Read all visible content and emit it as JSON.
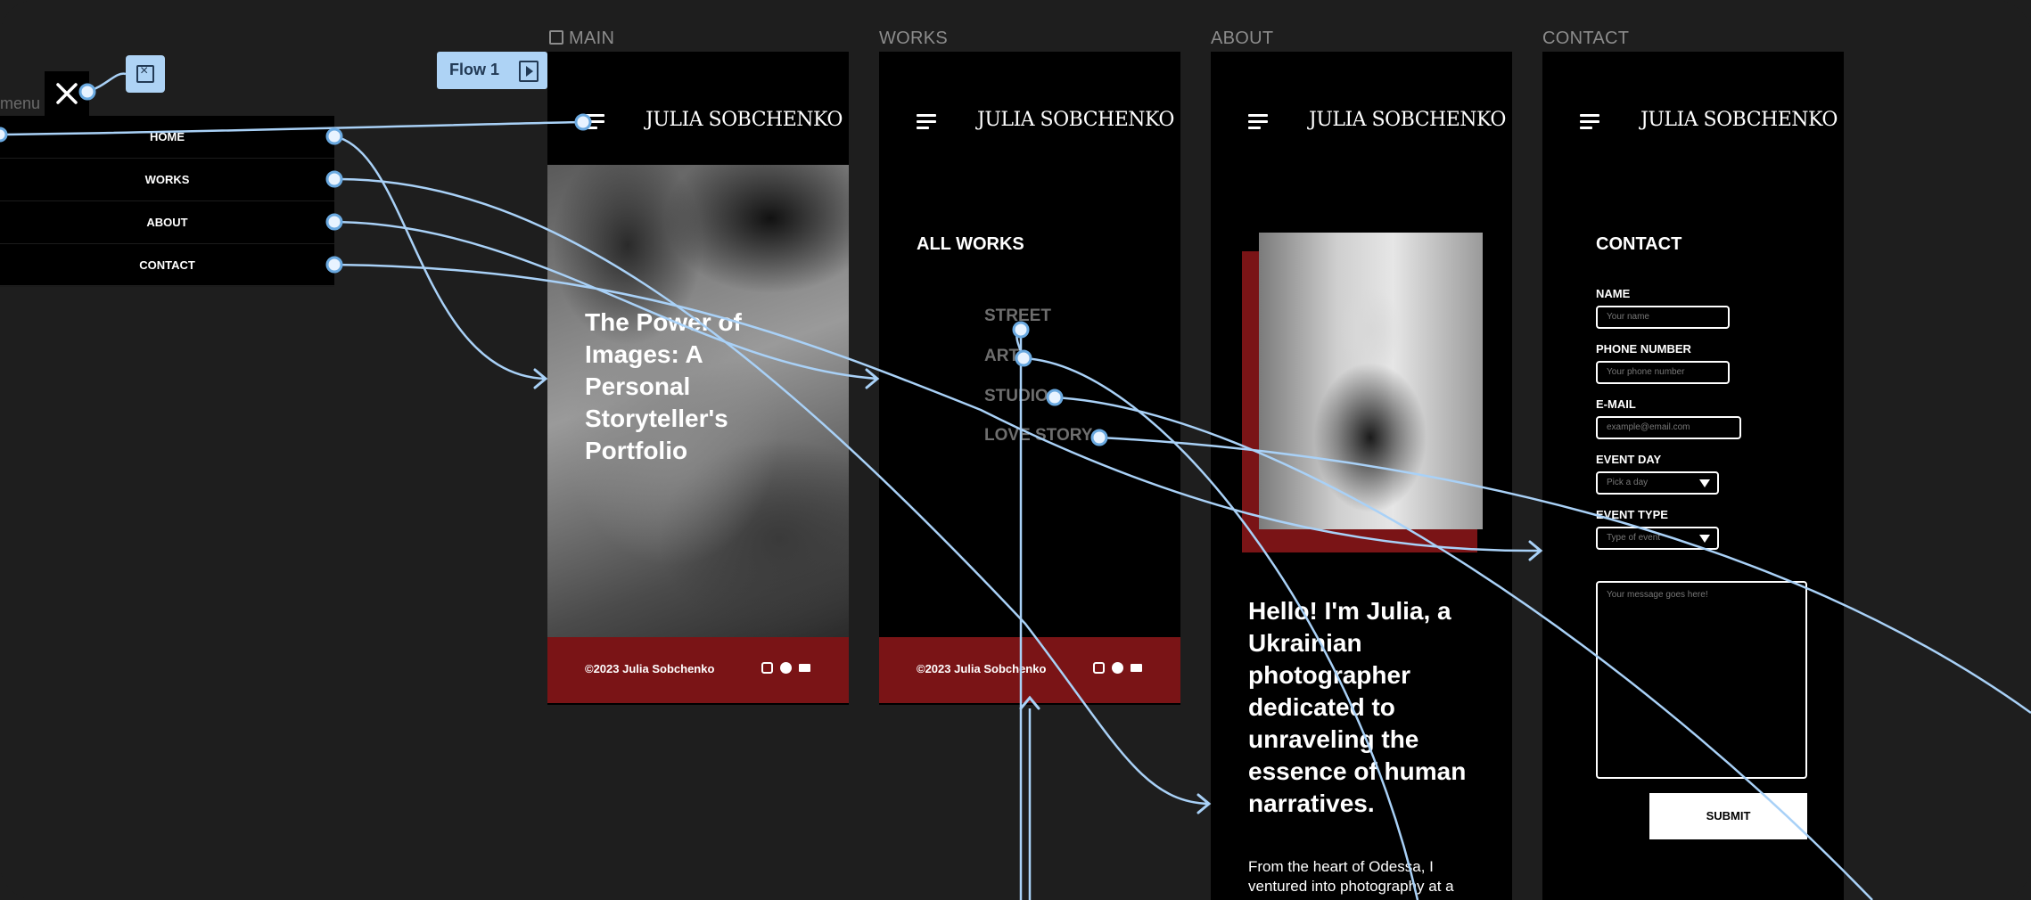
{
  "frames": {
    "main_label": "MAIN",
    "works_label": "WORKS",
    "about_label": "ABOUT",
    "contact_label": "CONTACT"
  },
  "brand": {
    "logo": "JULIA SOBCHENKO"
  },
  "main": {
    "hero_title": "The Power of Images: A Personal Storyteller's Portfolio",
    "footer_copy": "©2023 Julia Sobchenko"
  },
  "works": {
    "title": "ALL WORKS",
    "links": [
      "STREET",
      "ART",
      "STUDIO",
      "LOVE STORY"
    ],
    "footer_copy": "©2023 Julia Sobchenko"
  },
  "about": {
    "headline": "Hello! I'm Julia, a Ukrainian photographer dedicated to unraveling the essence of human narratives.",
    "body": "From the heart of Odessa, I ventured into photography at a"
  },
  "contact": {
    "title": "CONTACT",
    "name_label": "NAME",
    "name_placeholder": "Your name",
    "phone_label": "PHONE NUMBER",
    "phone_placeholder": "Your phone number",
    "email_label": "E-MAIL",
    "email_placeholder": "example@email.com",
    "event_day_label": "EVENT DAY",
    "event_day_value": "Pick a day",
    "event_type_label": "EVENT TYPE",
    "event_type_value": "Type of event",
    "message_placeholder": "Your message goes here!",
    "submit_label": "SUBMIT"
  },
  "menu": {
    "label": "menu",
    "items": [
      "HOME",
      "WORKS",
      "ABOUT",
      "CONTACT"
    ]
  },
  "prototype": {
    "flow_label": "Flow 1"
  },
  "colors": {
    "accent": "#7a1416",
    "connector": "#a9d1f7",
    "canvas": "#1e1e1e"
  }
}
